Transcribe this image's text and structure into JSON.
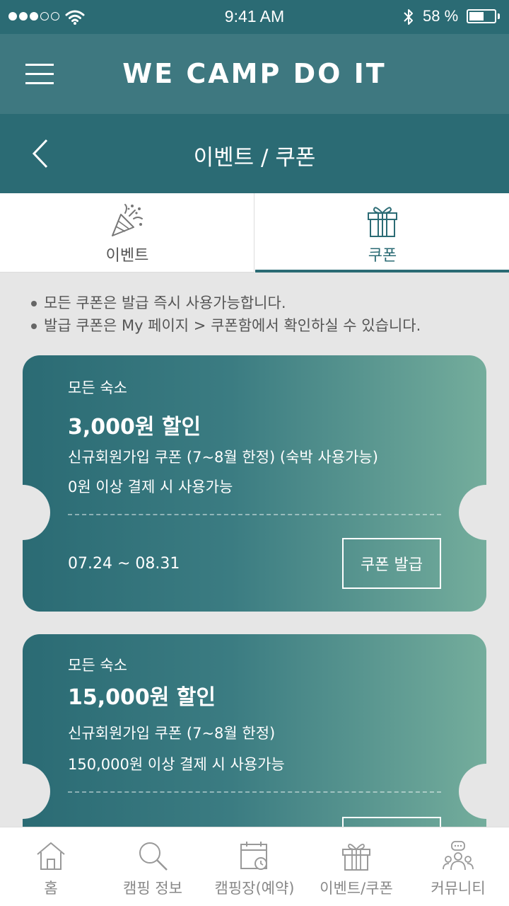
{
  "status_bar": {
    "time": "9:41 AM",
    "battery_percent": "58 %",
    "battery_level": 0.58,
    "signal_bars_filled": 3,
    "signal_bars_total": 5,
    "icons": [
      "signal-dots-icon",
      "wifi-icon",
      "bluetooth-icon",
      "battery-icon"
    ]
  },
  "header": {
    "brand": "WE CAMP DO IT",
    "menu_icon": "hamburger-icon"
  },
  "sub_header": {
    "title": "이벤트 / 쿠폰",
    "back_icon": "chevron-left-icon"
  },
  "tabs": [
    {
      "label": "이벤트",
      "icon": "party-popper-icon",
      "active": false
    },
    {
      "label": "쿠폰",
      "icon": "gift-icon",
      "active": true
    }
  ],
  "notices": [
    "모든 쿠폰은 발급 즉시 사용가능합니다.",
    "발급 쿠폰은 My 페이지 > 쿠폰함에서 확인하실 수 있습니다."
  ],
  "coupons": [
    {
      "scope": "모든 숙소",
      "amount": "3,000원 할인",
      "description": "신규회원가입 쿠폰 (7~8월 한정) (숙박 사용가능)",
      "condition": "0원 이상 결제 시 사용가능",
      "period": "07.24 ~ 08.31",
      "button": "쿠폰 발급"
    },
    {
      "scope": "모든 숙소",
      "amount": "15,000원 할인",
      "description": "신규회원가입 쿠폰 (7~8월 한정)",
      "condition": "150,000원 이상 결제 시 사용가능"
    }
  ],
  "bottom_nav": [
    {
      "label": "홈",
      "icon": "home-icon"
    },
    {
      "label": "캠핑 정보",
      "icon": "search-icon"
    },
    {
      "label": "캠핑장(예약)",
      "icon": "calendar-clock-icon"
    },
    {
      "label": "이벤트/쿠폰",
      "icon": "gift-icon"
    },
    {
      "label": "커뮤니티",
      "icon": "community-icon"
    }
  ],
  "colors": {
    "primary": "#2b6b74",
    "header": "#3e7880",
    "gradient_end": "#74ad9c",
    "background": "#e6e6e6"
  }
}
